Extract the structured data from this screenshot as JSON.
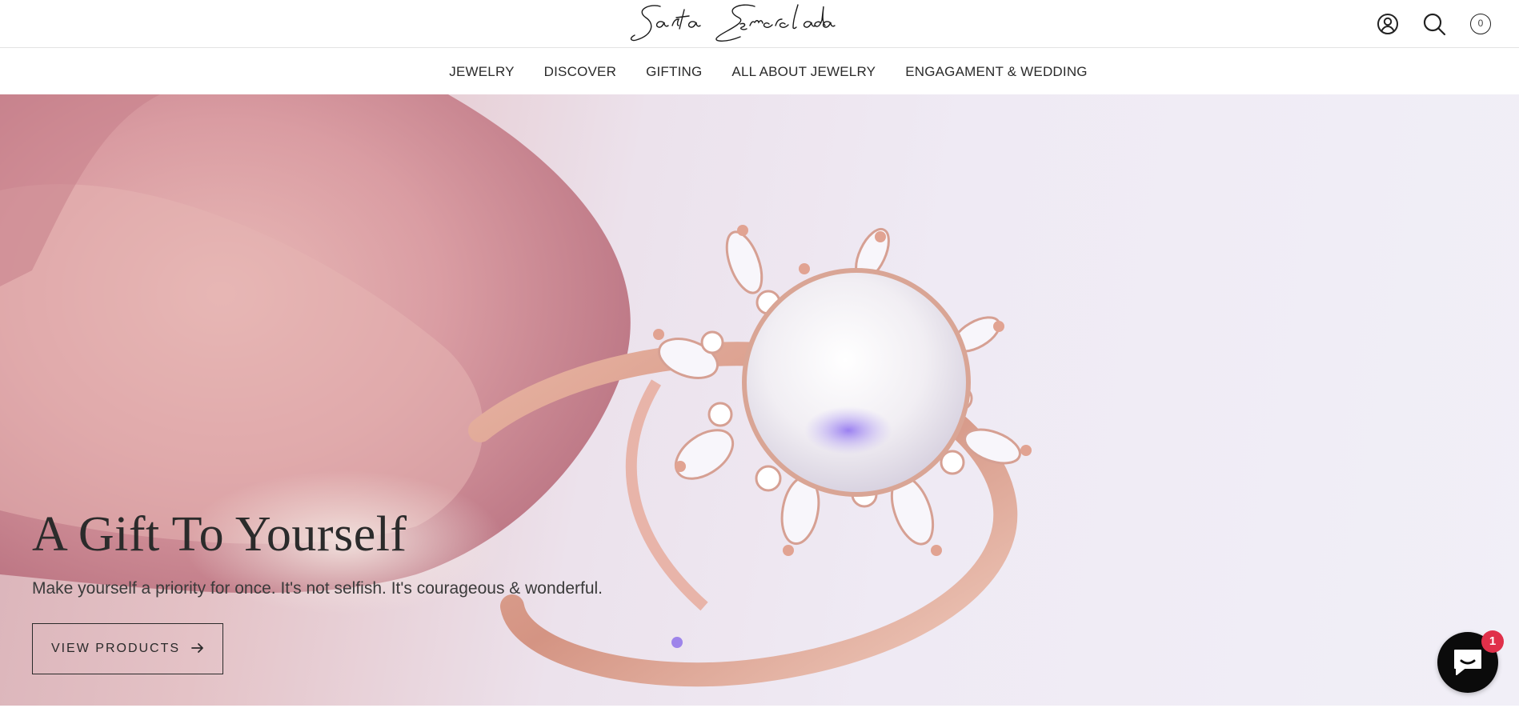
{
  "brand": {
    "logo_text": "Santa Esmeralda"
  },
  "header": {
    "account_icon": "account-icon",
    "search_icon": "search-icon",
    "cart": {
      "icon": "cart-icon",
      "count": "0"
    }
  },
  "nav": {
    "items": [
      {
        "label": "JEWELRY"
      },
      {
        "label": "DISCOVER"
      },
      {
        "label": "GIFTING"
      },
      {
        "label": "ALL ABOUT JEWELRY"
      },
      {
        "label": "ENGAGAMENT & WEDDING"
      }
    ]
  },
  "hero": {
    "title": "A Gift To Yourself",
    "subtitle": "Make yourself a priority for once. It's not selfish. It's courageous & wonderful.",
    "cta_label": "VIEW PRODUCTS",
    "cta_icon": "arrow-right-icon",
    "image": "rose-gold-moonstone-ring"
  },
  "chat": {
    "icon": "chat-icon",
    "badge_count": "1"
  },
  "colors": {
    "accent_badge": "#e0304a",
    "text": "#2b2b2b",
    "chat_button": "#0b0b0b"
  }
}
